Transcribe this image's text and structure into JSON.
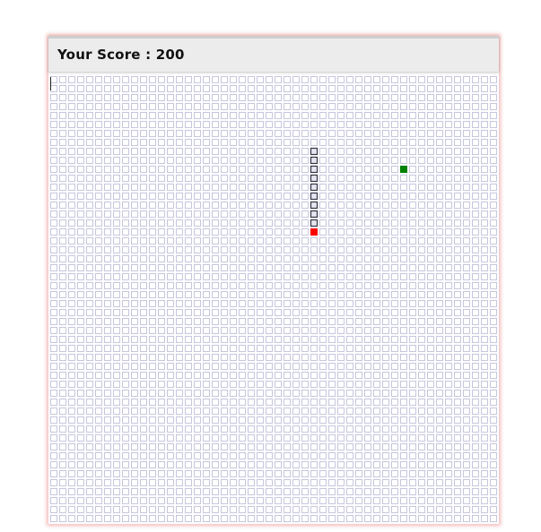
{
  "score": {
    "label": "Your Score : 200",
    "value": 200
  },
  "board": {
    "columns": 50,
    "rows": 50,
    "colors": {
      "empty_cell_border": "#b9b9d6",
      "snake_border": "#333344",
      "snake_fill": "#e6e6f0",
      "snake_head": "#ff0000",
      "food": "#008000",
      "panel_glow": "#e05050"
    },
    "snake_cells": [
      {
        "col": 29,
        "row": 8
      },
      {
        "col": 29,
        "row": 9
      },
      {
        "col": 29,
        "row": 10
      },
      {
        "col": 29,
        "row": 11
      },
      {
        "col": 29,
        "row": 12
      },
      {
        "col": 29,
        "row": 13
      },
      {
        "col": 29,
        "row": 14
      },
      {
        "col": 29,
        "row": 15
      },
      {
        "col": 29,
        "row": 16
      }
    ],
    "snake_head": {
      "col": 29,
      "row": 17
    },
    "food": {
      "col": 39,
      "row": 10
    }
  }
}
